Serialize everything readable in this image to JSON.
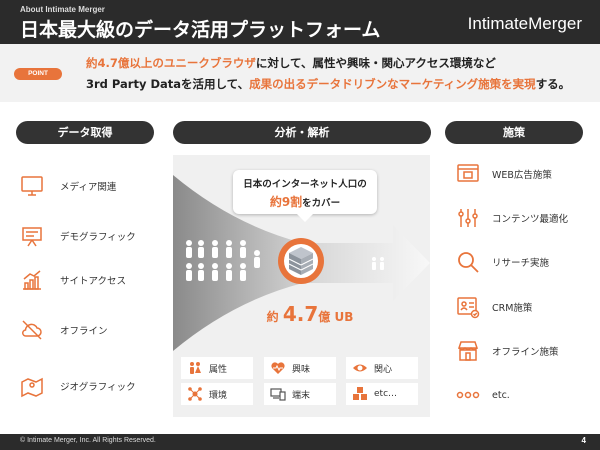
{
  "header": {
    "supertitle": "About Intimate Merger",
    "title": "日本最大級のデータ活用プラットフォーム",
    "logo_bold": "Intimate",
    "logo_thin": "Merger"
  },
  "point": {
    "badge": "POINT",
    "line1_orange": "約4.7億以上のユニークブラウザ",
    "line1_rest": "に対して、属性や興味・関心アクセス環境など",
    "line2_pre": "3rd Party Dataを活用して、",
    "line2_orange": "成果の出るデータドリブンなマーケティング施策を実現",
    "line2_post": "する。"
  },
  "columns": {
    "left": "データ取得",
    "center": "分析・解析",
    "right": "施策"
  },
  "left_items": [
    {
      "label": "メディア関連",
      "icon": "monitor-icon"
    },
    {
      "label": "デモグラフィック",
      "icon": "presentation-board-icon"
    },
    {
      "label": "サイトアクセス",
      "icon": "growth-chart-icon"
    },
    {
      "label": "オフライン",
      "icon": "cloud-off-icon"
    },
    {
      "label": "ジオグラフィック",
      "icon": "map-pin-icon"
    }
  ],
  "center": {
    "bubble_line1": "日本のインターネット人口の",
    "bubble_big": "約9割",
    "bubble_rest": "をカバー",
    "count_pre": "約 ",
    "count_num": "4.7",
    "count_post": "億 UB",
    "tags": [
      {
        "label": "属性",
        "icon": "people-icon"
      },
      {
        "label": "興味",
        "icon": "heart-pulse-icon"
      },
      {
        "label": "関心",
        "icon": "eye-icon"
      },
      {
        "label": "環境",
        "icon": "network-icon"
      },
      {
        "label": "端末",
        "icon": "devices-icon"
      },
      {
        "label": "etc…",
        "icon": "cubes-icon"
      }
    ]
  },
  "right_items": [
    {
      "label": "WEB広告施策",
      "icon": "browser-ad-icon"
    },
    {
      "label": "コンテンツ最適化",
      "icon": "sliders-icon"
    },
    {
      "label": "リサーチ実施",
      "icon": "magnifier-icon"
    },
    {
      "label": "CRM施策",
      "icon": "crm-card-icon"
    },
    {
      "label": "オフライン施策",
      "icon": "storefront-icon"
    },
    {
      "label": "etc.",
      "icon": "dots-icon"
    }
  ],
  "footer": {
    "copyright": "© Intimate Merger, Inc. All Rights Reserved.",
    "page": "4"
  },
  "colors": {
    "accent": "#e8743b",
    "dark": "#2b2b2b",
    "panel": "#f0f0f0"
  }
}
